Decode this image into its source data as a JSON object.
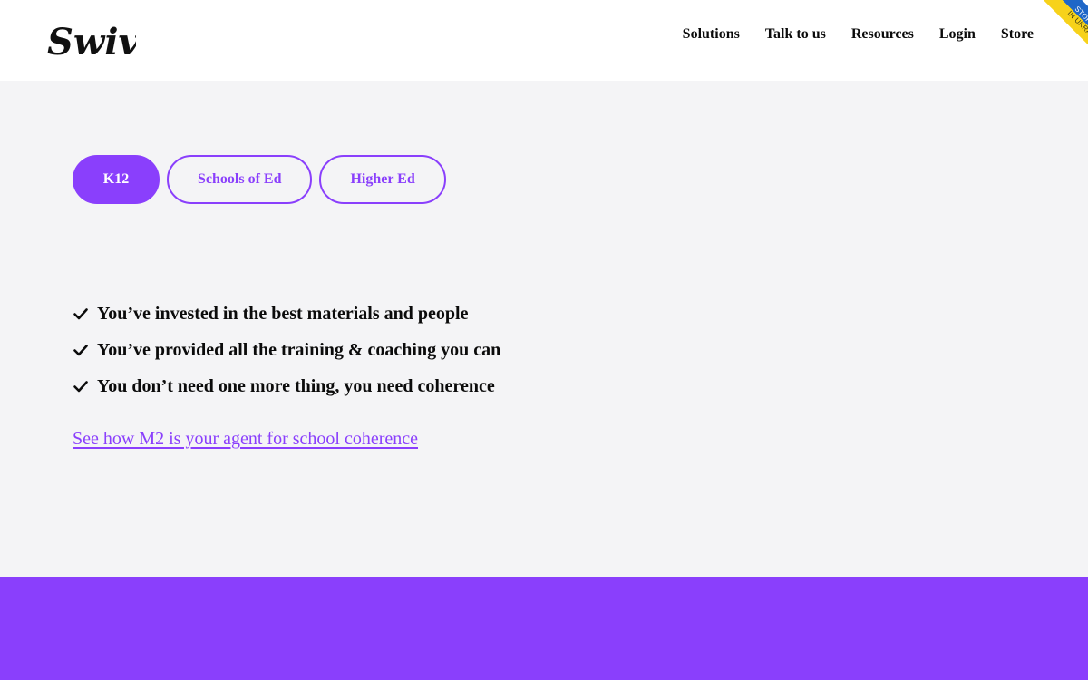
{
  "brand": {
    "logo_text": "Swivl"
  },
  "nav": {
    "items": [
      {
        "label": "Solutions"
      },
      {
        "label": "Talk to us"
      },
      {
        "label": "Resources"
      },
      {
        "label": "Login"
      },
      {
        "label": "Store"
      }
    ]
  },
  "ribbon": {
    "line1": "STOP WAR",
    "line2": "IN UKRAINE"
  },
  "tabs": [
    {
      "label": "K12",
      "active": true
    },
    {
      "label": "Schools of Ed",
      "active": false
    },
    {
      "label": "Higher Ed",
      "active": false
    }
  ],
  "benefits": [
    {
      "text": "You’ve invested in the best materials and people",
      "icon": "check-icon"
    },
    {
      "text": "You’ve provided all the training & coaching you can",
      "icon": "check-icon"
    },
    {
      "text": "You don’t need one more thing, you need coherence",
      "icon": "check-icon"
    }
  ],
  "cta_link": {
    "text": "See how M2 is your agent for school coherence"
  },
  "colors": {
    "accent": "#8a3ffc",
    "background": "#f4f4f6",
    "header_bg": "#ffffff",
    "text": "#0b0b0b",
    "ribbon_blue": "#1f67c7",
    "ribbon_yellow": "#f7d21a"
  }
}
